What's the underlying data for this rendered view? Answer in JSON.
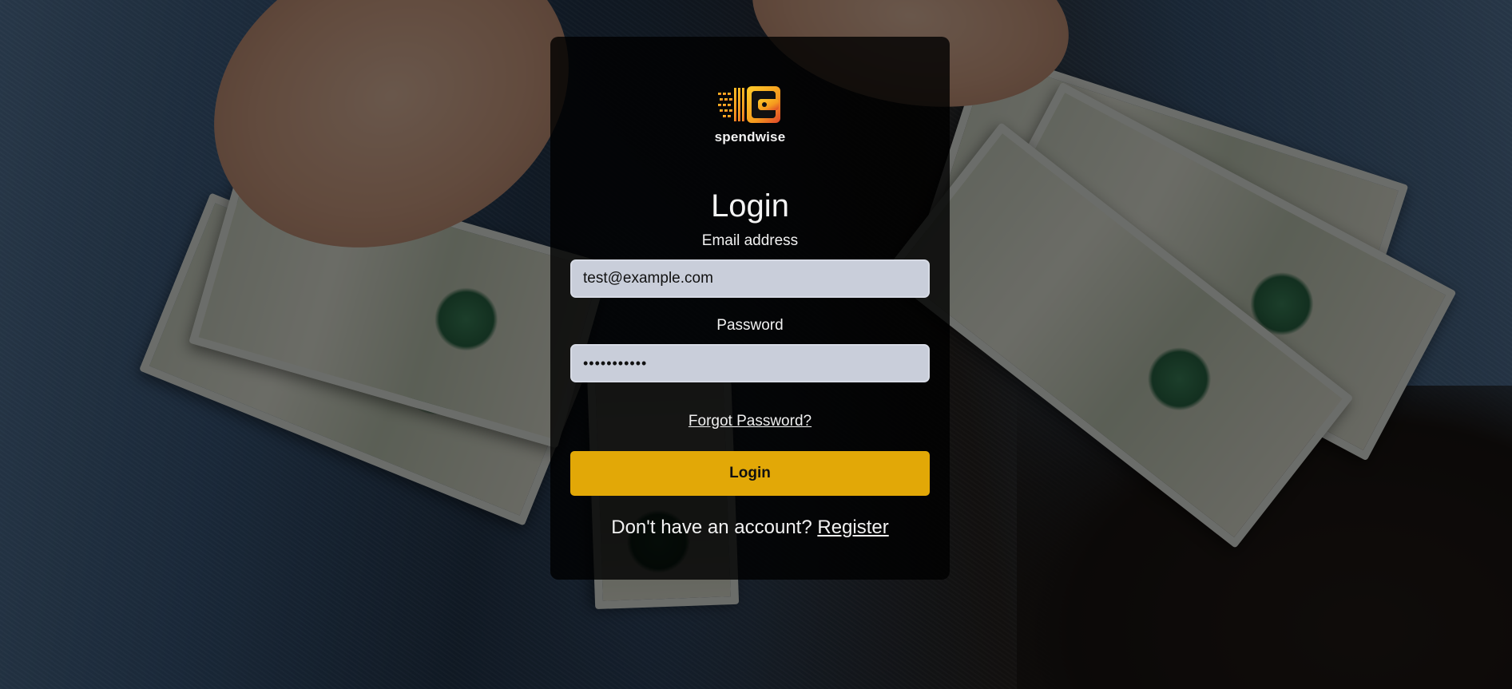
{
  "brand": {
    "name": "spendwise",
    "logo_icon": "wallet-icon",
    "accent": "#e2a807"
  },
  "form": {
    "title": "Login",
    "email_label": "Email address",
    "email_value": "test@example.com",
    "password_label": "Password",
    "password_value": "•••••••••••",
    "forgot_link": "Forgot Password?",
    "submit_label": "Login",
    "register_prompt": "Don't have an account?",
    "register_link": "Register"
  },
  "background": {
    "description_icon": "money-background-image"
  }
}
